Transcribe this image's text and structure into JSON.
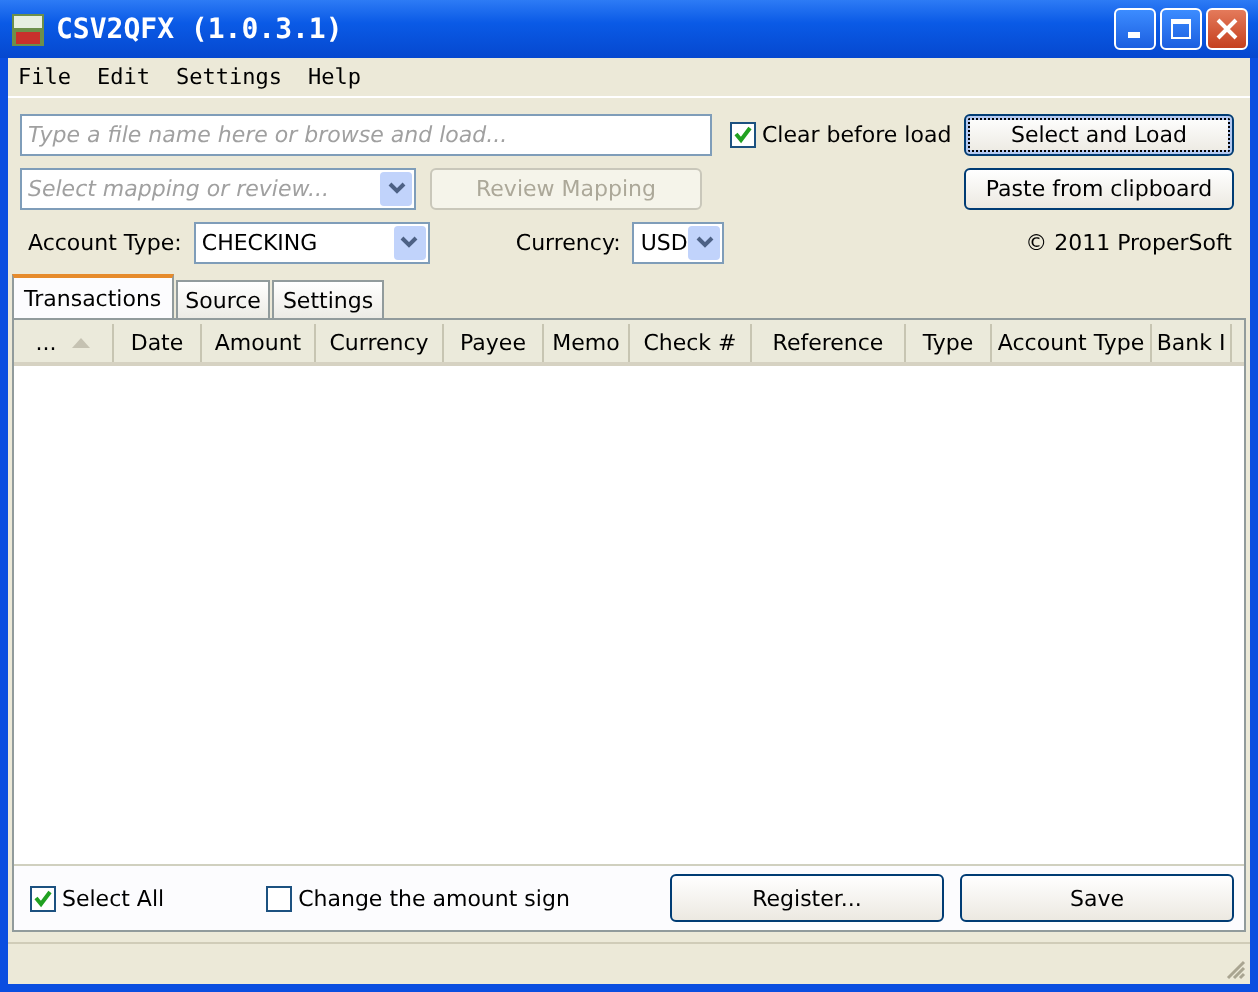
{
  "window": {
    "title": "CSV2QFX (1.0.3.1)"
  },
  "menu": [
    {
      "label": "File"
    },
    {
      "label": "Edit"
    },
    {
      "label": "Settings"
    },
    {
      "label": "Help"
    }
  ],
  "file_field": {
    "placeholder": "Type a file name here or browse and load..."
  },
  "clear_before_load": {
    "label": "Clear before load",
    "checked": true
  },
  "select_and_load": {
    "label": "Select and Load"
  },
  "mapping": {
    "placeholder": "Select mapping or review..."
  },
  "review_mapping": {
    "label": "Review Mapping",
    "disabled": true
  },
  "paste": {
    "label": "Paste from clipboard"
  },
  "account_type": {
    "label": "Account Type:",
    "value": "CHECKING"
  },
  "currency": {
    "label": "Currency:",
    "value": "USD"
  },
  "copyright": "© 2011 ProperSoft",
  "tabs": [
    {
      "label": "Transactions",
      "selected": true
    },
    {
      "label": "Source",
      "selected": false
    },
    {
      "label": "Settings",
      "selected": false
    }
  ],
  "table": {
    "columns": [
      {
        "label": "...",
        "sorted": true
      },
      {
        "label": "Date",
        "sorted": false
      },
      {
        "label": "Amount",
        "sorted": false
      },
      {
        "label": "Currency",
        "sorted": false
      },
      {
        "label": "Payee",
        "sorted": false
      },
      {
        "label": "Memo",
        "sorted": false
      },
      {
        "label": "Check #",
        "sorted": false
      },
      {
        "label": "Reference",
        "sorted": false
      },
      {
        "label": "Type",
        "sorted": false
      },
      {
        "label": "Account Type",
        "sorted": false
      },
      {
        "label": "Bank I",
        "sorted": false
      }
    ]
  },
  "select_all": {
    "label": "Select All",
    "checked": true
  },
  "change_sign": {
    "label": "Change the amount sign",
    "checked": false
  },
  "register": {
    "label": "Register..."
  },
  "save": {
    "label": "Save"
  }
}
